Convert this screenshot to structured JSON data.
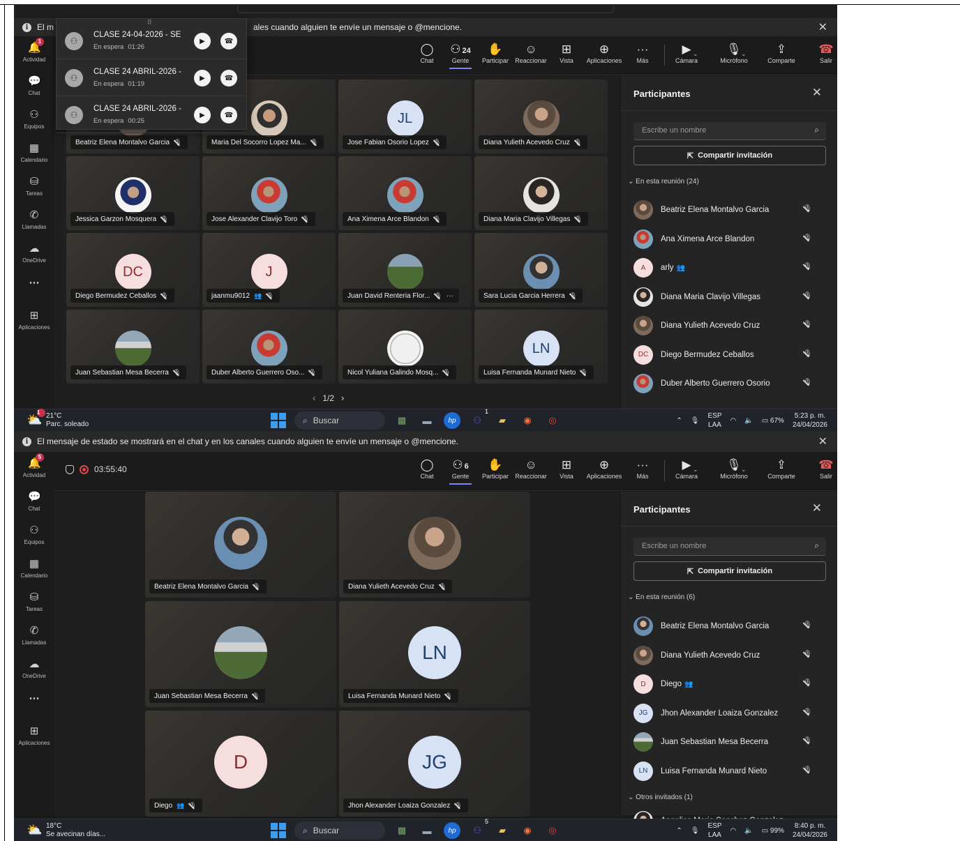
{
  "shot1": {
    "banner": "El mensaje de estado se mostrará en el chat y en los canales cuando alguien te envíe un mensaje o @mencione.",
    "banner_visible": "ales cuando alguien te envíe un mensaje o @mencione.",
    "banner_prefix": "El m",
    "rail": [
      {
        "label": "Actividad",
        "icon": "bell-icon",
        "badge": "1"
      },
      {
        "label": "Chat",
        "icon": "chat-icon"
      },
      {
        "label": "Equipos",
        "icon": "teams-icon"
      },
      {
        "label": "Calendario",
        "icon": "calendar-icon"
      },
      {
        "label": "Tareas",
        "icon": "tasks-icon"
      },
      {
        "label": "Llamadas",
        "icon": "phone-icon"
      },
      {
        "label": "OneDrive",
        "icon": "cloud-icon"
      },
      {
        "label": "...",
        "icon": "more-icon"
      },
      {
        "label": "Aplicaciones",
        "icon": "apps-icon"
      }
    ],
    "toolbar": {
      "chat": "Chat",
      "people": "Gente",
      "people_count": "24",
      "raise": "Participar",
      "react": "Reaccionar",
      "view": "Vista",
      "apps": "Aplicaciones",
      "more": "Más",
      "camera": "Cámara",
      "mic": "Micrófono",
      "share": "Comparte",
      "leave": "Salir"
    },
    "calls": [
      {
        "title": "CLASE 24-04-2026 - SE",
        "status": "En espera",
        "time": "01:26"
      },
      {
        "title": "CLASE 24 ABRIL-2026 -",
        "status": "En espera",
        "time": "01:19"
      },
      {
        "title": "CLASE 24 ABRIL-2026 -",
        "status": "En espera",
        "time": "00:25"
      }
    ],
    "tiles": [
      {
        "name": "Beatriz Elena Montalvo Garcia",
        "initials": "",
        "style": "photo"
      },
      {
        "name": "Maria Del Socorro Lopez Ma...",
        "initials": "",
        "style": "photo6"
      },
      {
        "name": "Jose Fabian Osorio Lopez",
        "initials": "JL",
        "style": "initials"
      },
      {
        "name": "Diana Yulieth Acevedo Cruz",
        "initials": "",
        "style": "photo"
      },
      {
        "name": "Jessica Garzon Mosquera",
        "initials": "",
        "style": "photo3"
      },
      {
        "name": "Jose Alexander Clavijo Toro",
        "initials": "",
        "style": "photo4"
      },
      {
        "name": "Ana Ximena Arce Blandon",
        "initials": "",
        "style": "photo4"
      },
      {
        "name": "Diana Maria Clavijo Villegas",
        "initials": "",
        "style": "photo2"
      },
      {
        "name": "Diego Bermudez Ceballos",
        "initials": "DC",
        "style": "initials-pink"
      },
      {
        "name": "jaanmu9012",
        "initials": "J",
        "style": "initials-pink",
        "guest": true
      },
      {
        "name": "Juan David Renteria Flor...",
        "initials": "",
        "style": "photo5",
        "more": "···"
      },
      {
        "name": "Sara Lucia Garcia Herrera",
        "initials": "",
        "style": "photo7"
      },
      {
        "name": "Juan Sebastian Mesa Becerra",
        "initials": "",
        "style": "flowers"
      },
      {
        "name": "Duber Alberto Guerrero Oso...",
        "initials": "",
        "style": "photo4"
      },
      {
        "name": "Nicol Yuliana Galindo Mosq...",
        "initials": "",
        "style": "sketch"
      },
      {
        "name": "Luisa Fernanda Munard Nieto",
        "initials": "LN",
        "style": "initials"
      }
    ],
    "pager": "1/2",
    "panel": {
      "title": "Participantes",
      "search_placeholder": "Escribe un nombre",
      "invite": "Compartir invitación",
      "section": "En esta reunión (24)",
      "people": [
        {
          "name": "Beatriz Elena Montalvo Garcia",
          "initials": "",
          "style": "photo"
        },
        {
          "name": "Ana Ximena Arce Blandon",
          "initials": "",
          "style": "photo4"
        },
        {
          "name": "arly",
          "initials": "A",
          "style": "pink",
          "guest": true
        },
        {
          "name": "Diana Maria Clavijo Villegas",
          "initials": "",
          "style": "photo2"
        },
        {
          "name": "Diana Yulieth Acevedo Cruz",
          "initials": "",
          "style": "photo"
        },
        {
          "name": "Diego Bermudez Ceballos",
          "initials": "DC",
          "style": "pink"
        },
        {
          "name": "Duber Alberto Guerrero Osorio",
          "initials": "",
          "style": "photo4"
        }
      ]
    },
    "taskbar": {
      "temp": "21°C",
      "weather": "Parc. soleado",
      "weather_badge": "1",
      "search": "Buscar",
      "teams_badge": "1",
      "lang1": "ESP",
      "lang2": "LAA",
      "battery": "67%",
      "time": "5:23 p. m.",
      "date": "24/04/2026"
    }
  },
  "shot2": {
    "banner": "El mensaje de estado se mostrará en el chat y en los canales cuando alguien te envíe un mensaje o @mencione.",
    "timer": "03:55:40",
    "rail_badge": "5",
    "toolbar_people_count": "6",
    "tiles": [
      {
        "name": "Beatriz Elena Montalvo Garcia",
        "initials": "",
        "style": "photo7"
      },
      {
        "name": "Diana Yulieth Acevedo Cruz",
        "initials": "",
        "style": "photo"
      },
      {
        "name": "Juan Sebastian Mesa Becerra",
        "initials": "",
        "style": "flowers"
      },
      {
        "name": "Luisa Fernanda Munard Nieto",
        "initials": "LN",
        "style": "initials"
      },
      {
        "name": "Diego",
        "initials": "D",
        "style": "initials-pink",
        "guest": true
      },
      {
        "name": "Jhon Alexander Loaiza Gonzalez",
        "initials": "JG",
        "style": "initials"
      }
    ],
    "panel": {
      "title": "Participantes",
      "search_placeholder": "Escribe un nombre",
      "invite": "Compartir invitación",
      "section": "En esta reunión (6)",
      "people": [
        {
          "name": "Beatriz Elena Montalvo Garcia",
          "initials": "",
          "style": "photo7"
        },
        {
          "name": "Diana Yulieth Acevedo Cruz",
          "initials": "",
          "style": "photo"
        },
        {
          "name": "Diego",
          "initials": "D",
          "style": "pink",
          "guest": true
        },
        {
          "name": "Jhon Alexander Loaiza Gonzalez",
          "initials": "JG",
          "style": "blue"
        },
        {
          "name": "Juan Sebastian Mesa Becerra",
          "initials": "",
          "style": "flowers"
        },
        {
          "name": "Luisa Fernanda Munard Nieto",
          "initials": "LN",
          "style": "blue"
        }
      ],
      "section2": "Otros invitados (1)",
      "invited": [
        {
          "name": "Angelica Maria Sanchez Gonzalez",
          "initials": "",
          "style": "photo2"
        }
      ]
    },
    "taskbar": {
      "temp": "18°C",
      "weather": "Se avecinan días...",
      "search": "Buscar",
      "teams_badge": "5",
      "lang1": "ESP",
      "lang2": "LAA",
      "battery": "99%",
      "time": "8:40 p. m.",
      "date": "24/04/2026"
    }
  },
  "colors": {
    "accent": "#7f85f5",
    "leave": "#e9595f",
    "badge": "#c4314b",
    "initials_blue_bg": "#d7e2f5",
    "initials_blue_fg": "#23406e",
    "initials_pink_bg": "#f6dede",
    "initials_pink_fg": "#8a2f2f"
  }
}
